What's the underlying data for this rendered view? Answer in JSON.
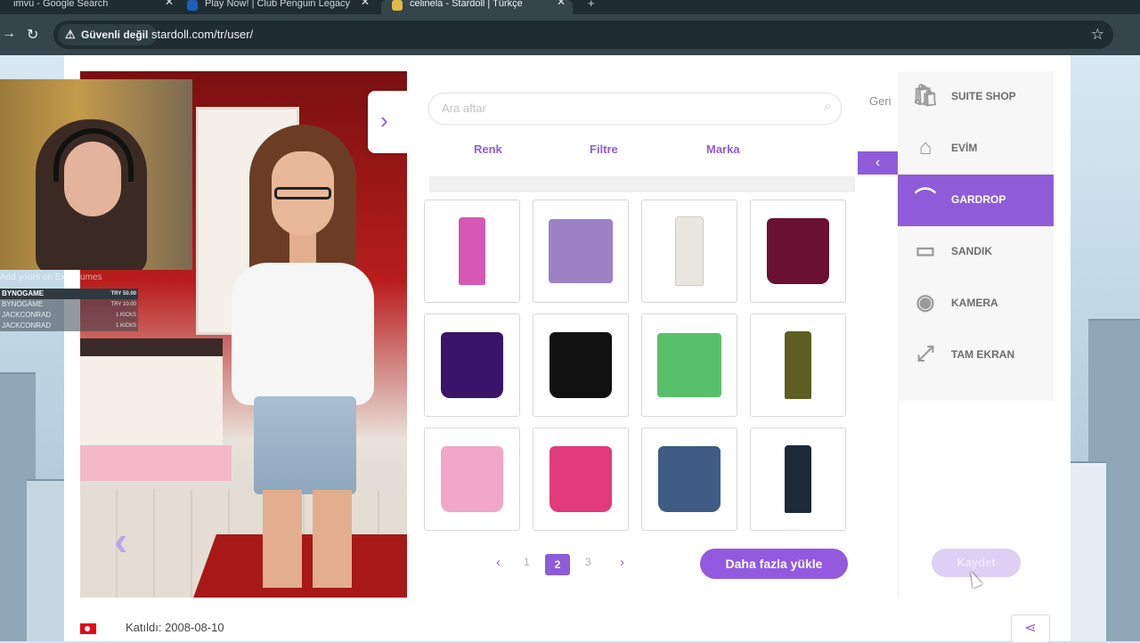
{
  "browser": {
    "tabs": [
      {
        "title": "imvu - Google Search",
        "close": "✕",
        "fav_color": "#4285f4"
      },
      {
        "title": "Play Now! | Club Penguin Legacy",
        "close": "✕",
        "fav_color": "#1c5fb8"
      },
      {
        "title": "celinela - Stardoll | Türkçe",
        "close": "✕",
        "fav_color": "#e0b848"
      }
    ],
    "new_tab": "+",
    "security_label": "Güvenli değil",
    "url": "stardoll.com/tr/user/"
  },
  "webcam": {
    "caption": "Add yours on Exordiumes",
    "scoreboard": [
      {
        "name": "BYNOGAME",
        "value": "TRY 50.00"
      },
      {
        "name": "BYNOGAME",
        "value": "TRY 10.00"
      },
      {
        "name": "JACKCONRAD",
        "value": "1 KICKS"
      },
      {
        "name": "JACKCONRAD",
        "value": "1 KICKS"
      }
    ]
  },
  "store": {
    "search_placeholder": "Ara aftar",
    "filters": [
      "Renk",
      "Filtre",
      "Marka"
    ],
    "items": [
      {
        "name": "pink-leggings",
        "color": "#d458b4"
      },
      {
        "name": "patterned-shorts",
        "color": "#9a82c4"
      },
      {
        "name": "white-pants",
        "color": "#e8e6df"
      },
      {
        "name": "burgundy-skirt",
        "color": "#6a1030"
      },
      {
        "name": "purple-skirt",
        "color": "#3a1468"
      },
      {
        "name": "black-pencil-skirt",
        "color": "#111111"
      },
      {
        "name": "green-shorts",
        "color": "#58c06a"
      },
      {
        "name": "olive-cargo-pants",
        "color": "#5c5e22"
      },
      {
        "name": "pink-studded-skirt",
        "color": "#f0a7c8"
      },
      {
        "name": "pink-leopard-skirt",
        "color": "#e13a7a"
      },
      {
        "name": "denim-skirt",
        "color": "#3e5c84"
      },
      {
        "name": "dark-skinny-jeans",
        "color": "#1c2a3a"
      }
    ],
    "pagination": {
      "prev": "‹",
      "pages": [
        "1",
        "2",
        "3"
      ],
      "current": "2",
      "next": "›"
    },
    "load_more": "Daha fazla yükle"
  },
  "sidebar": {
    "back_label": "Geri",
    "items": [
      {
        "label": "SUITE SHOP",
        "icon": "shopping-bag-icon",
        "glyph": "🛍"
      },
      {
        "label": "EVİM",
        "icon": "home-icon",
        "glyph": "⌂"
      },
      {
        "label": "GARDROP",
        "icon": "hanger-icon",
        "glyph": "⌒"
      },
      {
        "label": "SANDIK",
        "icon": "chest-icon",
        "glyph": "▭"
      },
      {
        "label": "KAMERA",
        "icon": "camera-icon",
        "glyph": "◉"
      },
      {
        "label": "TAM EKRAN",
        "icon": "fullscreen-icon",
        "glyph": "⤢"
      }
    ],
    "active": "GARDROP",
    "save_label": "Kaydet"
  },
  "footer": {
    "joined": "Katıldı: 2008-08-10"
  },
  "colors": {
    "accent": "#8e5cd8",
    "room_red": "#b81d1d"
  }
}
